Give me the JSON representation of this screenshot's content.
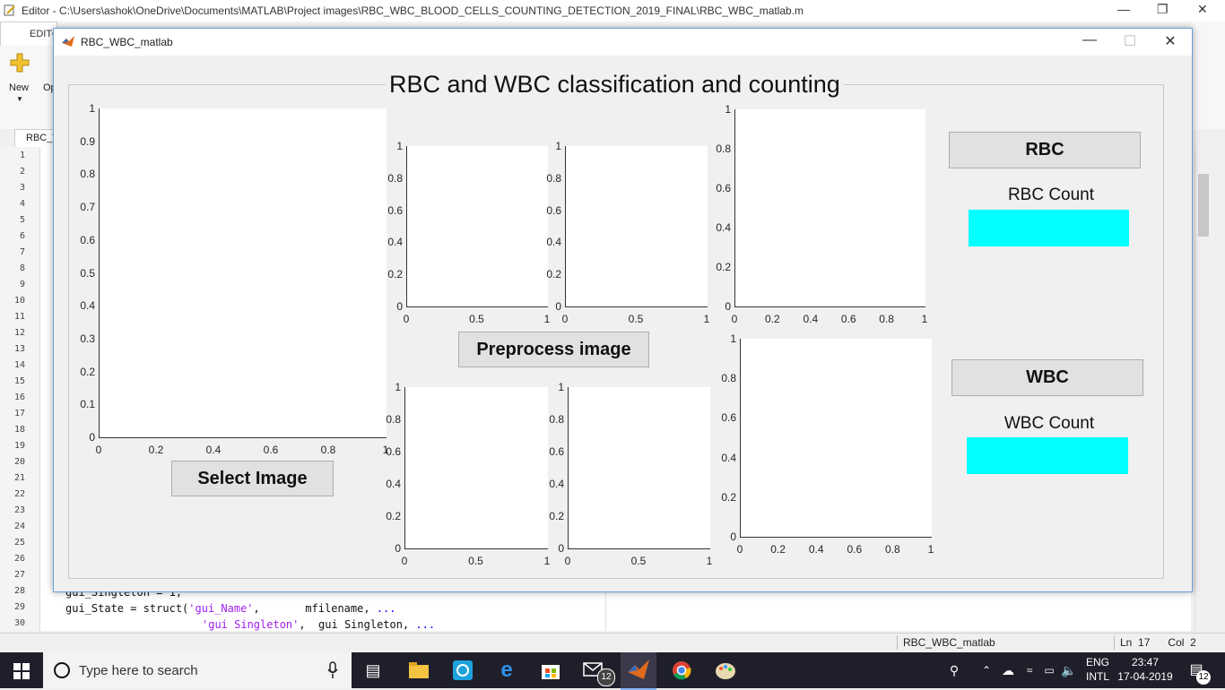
{
  "editor": {
    "window_title": "Editor - C:\\Users\\ashok\\OneDrive\\Documents\\MATLAB\\Project images\\RBC_WBC_BLOOD_CELLS_COUNTING_DETECTION_2019_FINAL\\RBC_WBC_matlab.m",
    "toolstrip_tab": "EDITO",
    "new_label": "New",
    "open_label": "Op",
    "file_tab": "RBC_W",
    "line_numbers": [
      "1",
      "2",
      "3",
      "4",
      "5",
      "6",
      "7",
      "8",
      "9",
      "10",
      "11",
      "12",
      "13",
      "14",
      "15",
      "16",
      "17",
      "18",
      "19",
      "20",
      "21",
      "22",
      "23",
      "24",
      "25",
      "26",
      "27",
      "28",
      "29",
      "30"
    ],
    "code_line_28": "gui_Singleton = 1;",
    "code_line_29_a": "gui_State = struct(",
    "code_line_29_str": "'gui_Name'",
    "code_line_29_b": ",       mfilename, ",
    "code_line_29_cont": "...",
    "code_line_30_str": "'gui Singleton'",
    "code_line_30_b": ",  gui Singleton, ",
    "code_line_30_cont": "...",
    "status_file": "RBC_WBC_matlab",
    "status_ln_label": "Ln",
    "status_ln": "17",
    "status_col_label": "Col",
    "status_col": "2"
  },
  "figure": {
    "window_title": "RBC_WBC_matlab",
    "panel_title": "RBC and WBC classification and counting",
    "select_button": "Select Image",
    "preprocess_button": "Preprocess image",
    "rbc_button": "RBC",
    "rbc_count_label": "RBC Count",
    "wbc_button": "WBC",
    "wbc_count_label": "WBC Count",
    "count_box_color": "#00ffff",
    "axes_ticks": {
      "big_y": [
        "1",
        "0.9",
        "0.8",
        "0.7",
        "0.6",
        "0.5",
        "0.4",
        "0.3",
        "0.2",
        "0.1",
        "0"
      ],
      "big_x": [
        "0",
        "0.2",
        "0.4",
        "0.6",
        "0.8",
        "1"
      ],
      "small_y": [
        "1",
        "0.8",
        "0.6",
        "0.4",
        "0.2",
        "0"
      ],
      "small_x": [
        "0",
        "0.5",
        "1"
      ],
      "right_x": [
        "0",
        "0.2",
        "0.4",
        "0.6",
        "0.8",
        "1"
      ]
    }
  },
  "taskbar": {
    "search_placeholder": "Type here to search",
    "lang_top": "ENG",
    "lang_bottom": "INTL",
    "time": "23:47",
    "date": "17-04-2019",
    "mail_badge": "12",
    "notif_badge": "12"
  }
}
